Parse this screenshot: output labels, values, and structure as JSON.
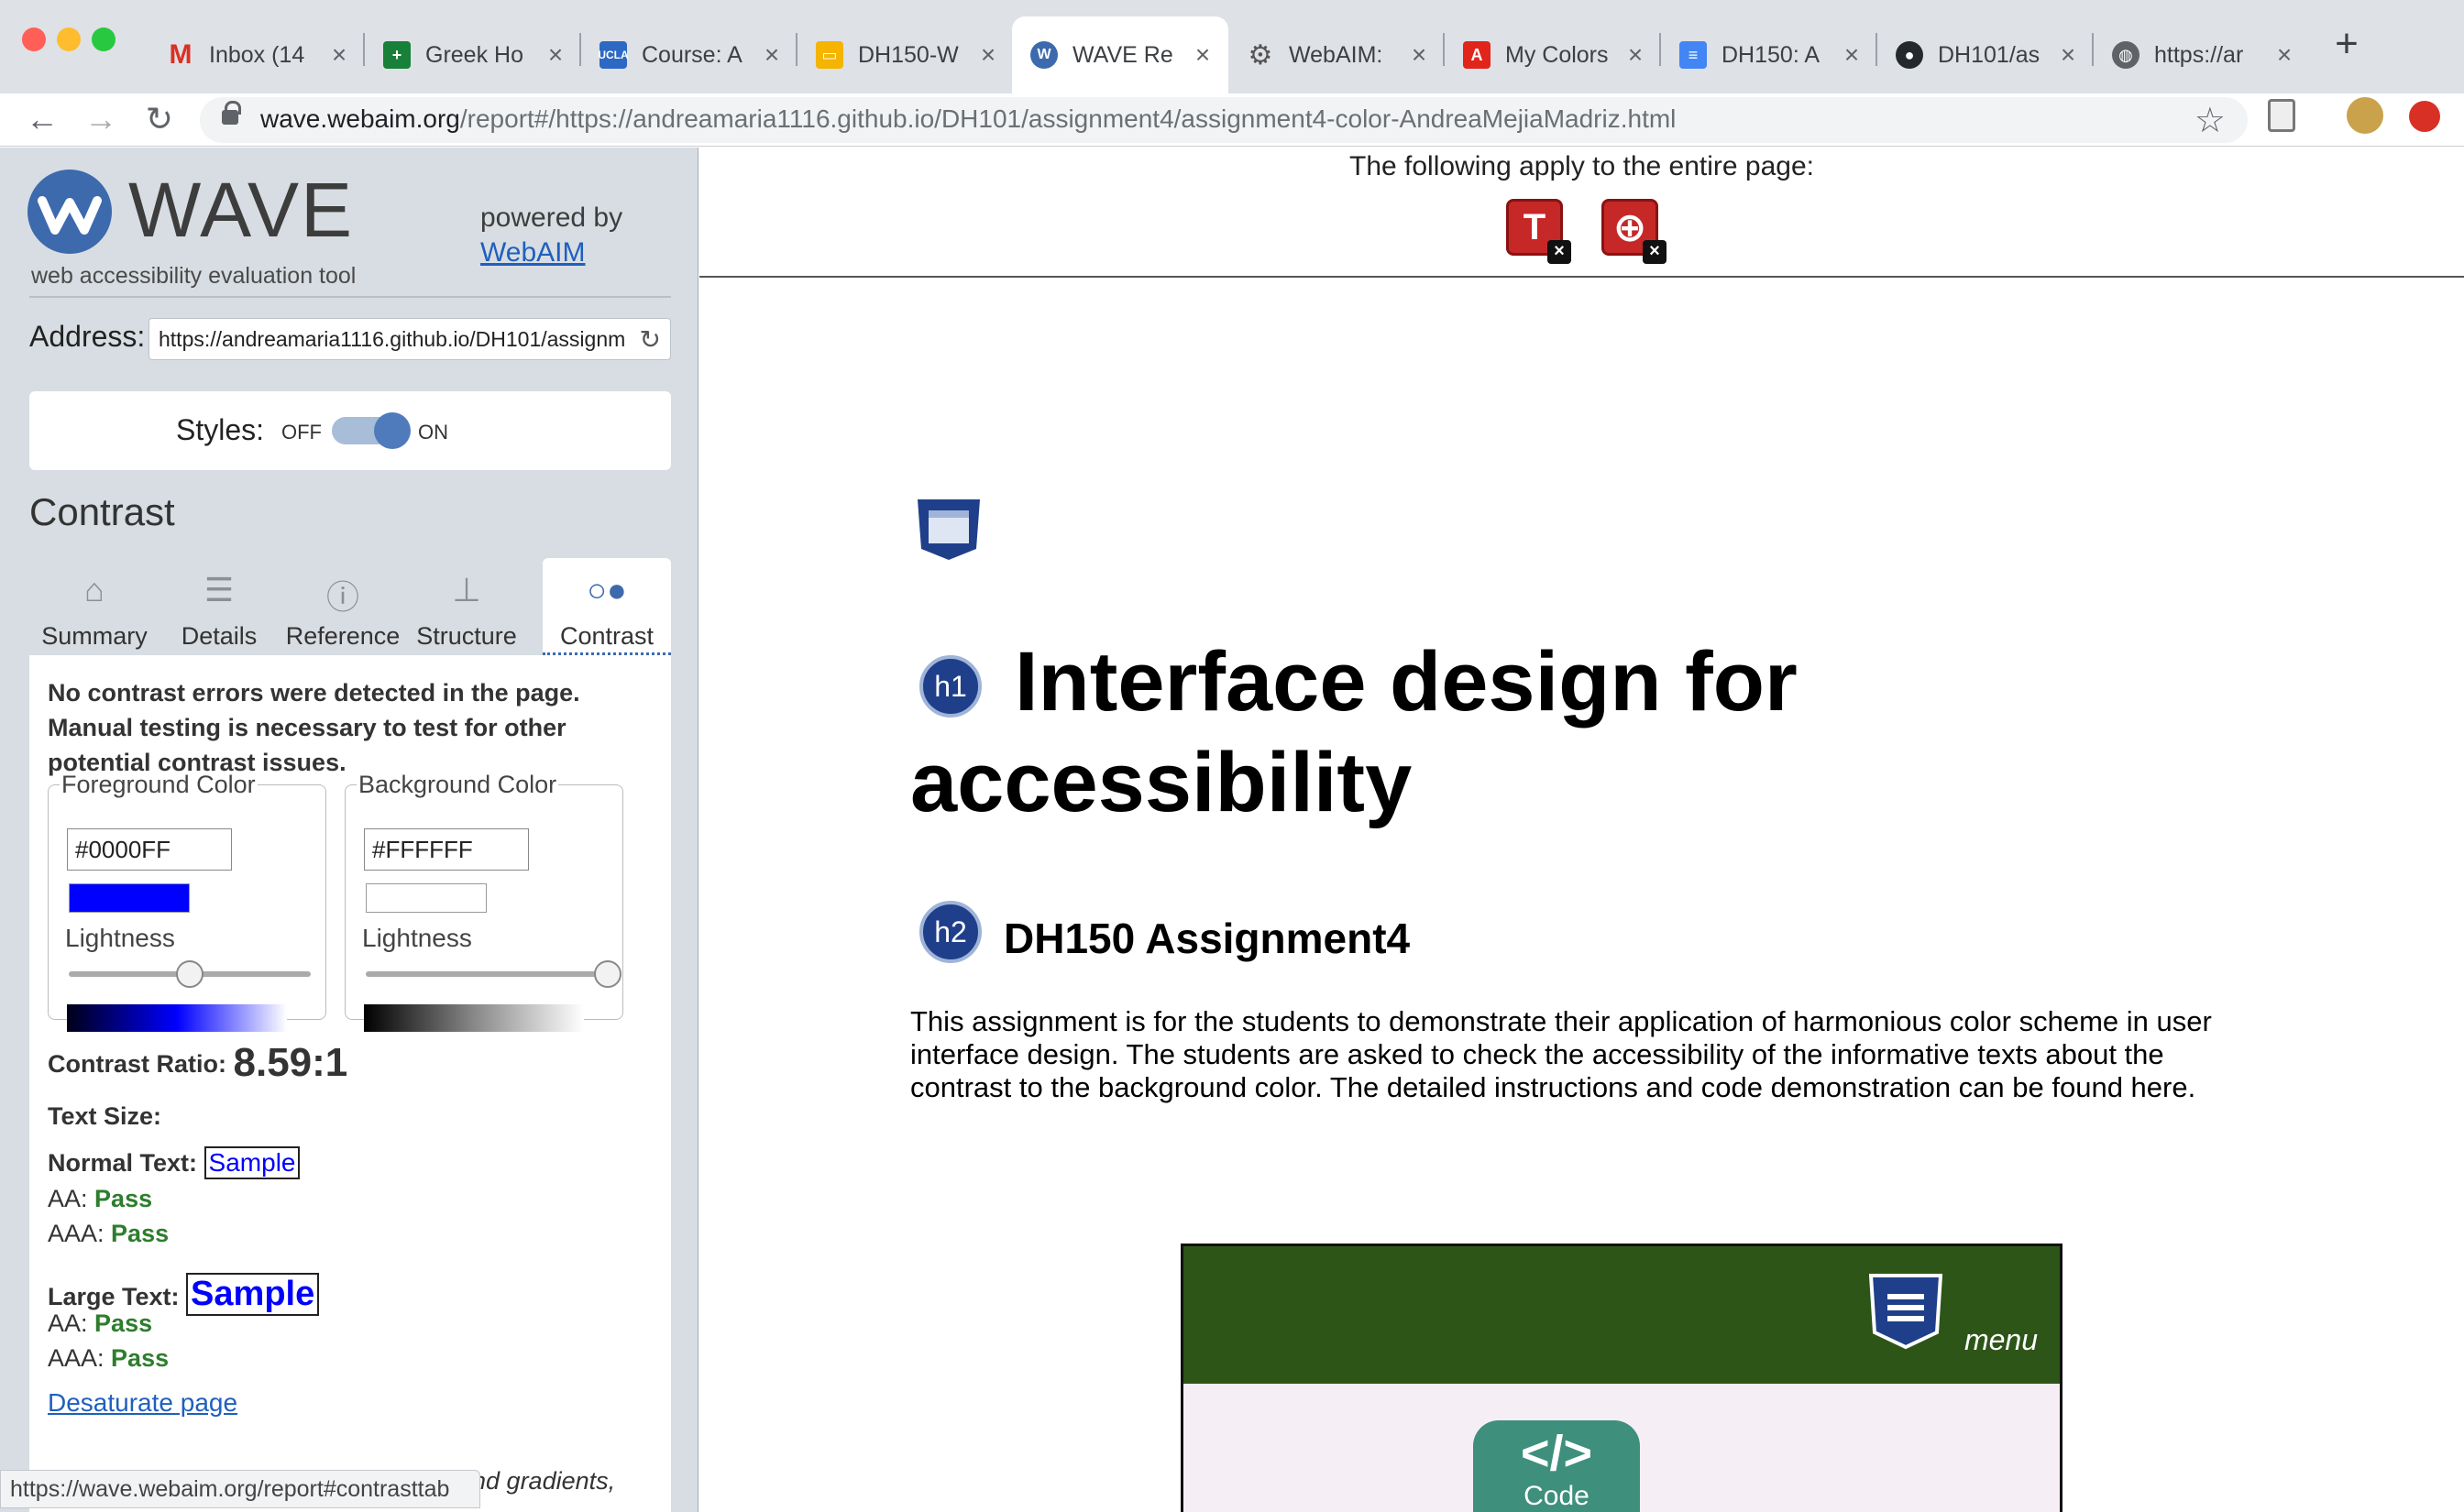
{
  "browser": {
    "tabs": [
      {
        "title": "Inbox (14",
        "icon": "gmail-icon",
        "color": "#d93025"
      },
      {
        "title": "Greek Ho",
        "icon": "sheets-icon",
        "color": "#188038"
      },
      {
        "title": "Course: A",
        "icon": "ucla-icon",
        "color": "#2d68c4"
      },
      {
        "title": "DH150-W",
        "icon": "slides-icon",
        "color": "#f4b400"
      },
      {
        "title": "WAVE Re",
        "icon": "wave-icon",
        "color": "#3c6aad"
      },
      {
        "title": "WebAIM:",
        "icon": "gear-icon",
        "color": "#555555"
      },
      {
        "title": "My Colors",
        "icon": "adobe-icon",
        "color": "#e1251b"
      },
      {
        "title": "DH150: A",
        "icon": "docs-icon",
        "color": "#4285f4"
      },
      {
        "title": "DH101/as",
        "icon": "github-icon",
        "color": "#24292e"
      },
      {
        "title": "https://ar",
        "icon": "globe-icon",
        "color": "#5f6368"
      }
    ],
    "url_host": "wave.webaim.org",
    "url_rest": "/report#/https://andreamaria1116.github.io/DH101/assignment4/assignment4-color-AndreaMejiaMadriz.html",
    "status_url": "https://wave.webaim.org/report#contrasttab"
  },
  "wave": {
    "logo_text": "WAVE",
    "tagline": "web accessibility evaluation tool",
    "powered_by": "powered by",
    "webaim_link": "WebAIM",
    "address_label": "Address:",
    "address_value": "https://andreamaria1116.github.io/DH101/assignment4/assignment4-color-AndreaMejiaMadriz.html",
    "styles_label": "Styles:",
    "styles_off": "OFF",
    "styles_on": "ON",
    "section_title": "Contrast",
    "tabs": [
      "Summary",
      "Details",
      "Reference",
      "Structure",
      "Contrast"
    ],
    "message": "No contrast errors were detected in the page. Manual testing is necessary to test for other potential contrast issues.",
    "foreground": {
      "legend": "Foreground Color",
      "hex": "#0000FF",
      "lightness_label": "Lightness",
      "lightness": 0.5
    },
    "background": {
      "legend": "Background Color",
      "hex": "#FFFFFF",
      "lightness_label": "Lightness",
      "lightness": 1.0
    },
    "contrast_ratio_label": "Contrast Ratio:",
    "contrast_ratio": "8.59:1",
    "text_size_label": "Text Size:",
    "normal_text_label": "Normal Text:",
    "large_text_label": "Large Text:",
    "sample": "Sample",
    "aa_label": "AA:",
    "aaa_label": "AAA:",
    "pass": "Pass",
    "desaturate_link": "Desaturate page",
    "cutoff_text": "und gradients,"
  },
  "page": {
    "apply_text": "The following apply to the entire page:",
    "h1_badge": "h1",
    "h2_badge": "h2",
    "h1": "Interface design for accessibility",
    "h2": "DH150 Assignment4",
    "paragraph": "This assignment is for the students to demonstrate their application of harmonious color scheme in user interface design. The students are asked to check the accessibility of the informative texts about the contrast to the background color. The detailed instructions and code demonstration can be found here.",
    "menu_label": "menu",
    "code_glyph": "</>",
    "code_label": "Code"
  },
  "colors": {
    "wave_blue": "#3c6aad",
    "pass_green": "#2e7d2e",
    "demo_nav_green": "#2d5517",
    "error_red": "#c62828"
  }
}
